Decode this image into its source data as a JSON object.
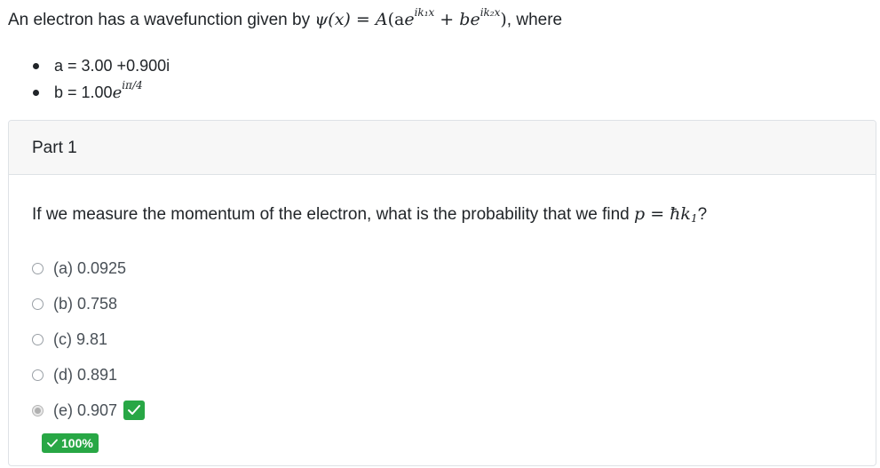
{
  "problem": {
    "intro_prefix": "An electron has a wavefunction given by ",
    "intro_suffix": ", where",
    "equation": {
      "lhs": "ψ(x) = ",
      "A": "A",
      "open": "(a",
      "e1": "e",
      "exp1": "ik₁x",
      "plus": " + b",
      "e2": "e",
      "exp2": "ik₂x",
      "close": ")"
    },
    "params": [
      {
        "label": "a = 3.00 +0.900i"
      },
      {
        "label_prefix": "b = 1.00",
        "e": "e",
        "exp": "iπ/4"
      }
    ]
  },
  "part": {
    "title": "Part 1",
    "question_prefix": "If we measure the momentum of the electron, what is the probability that we find ",
    "question_math": "p = ħk",
    "question_sub": "1",
    "question_suffix": "?",
    "options": [
      {
        "label": "(a) 0.0925",
        "selected": false
      },
      {
        "label": "(b) 0.758",
        "selected": false
      },
      {
        "label": "(c) 9.81",
        "selected": false
      },
      {
        "label": "(d) 0.891",
        "selected": false
      },
      {
        "label": "(e) 0.907",
        "selected": true
      }
    ],
    "score": "100%"
  },
  "colors": {
    "success": "#28a745",
    "header_bg": "#f7f7f7",
    "border": "#dee2e6"
  },
  "icons": {
    "correct": "check-icon",
    "score": "check-icon"
  }
}
